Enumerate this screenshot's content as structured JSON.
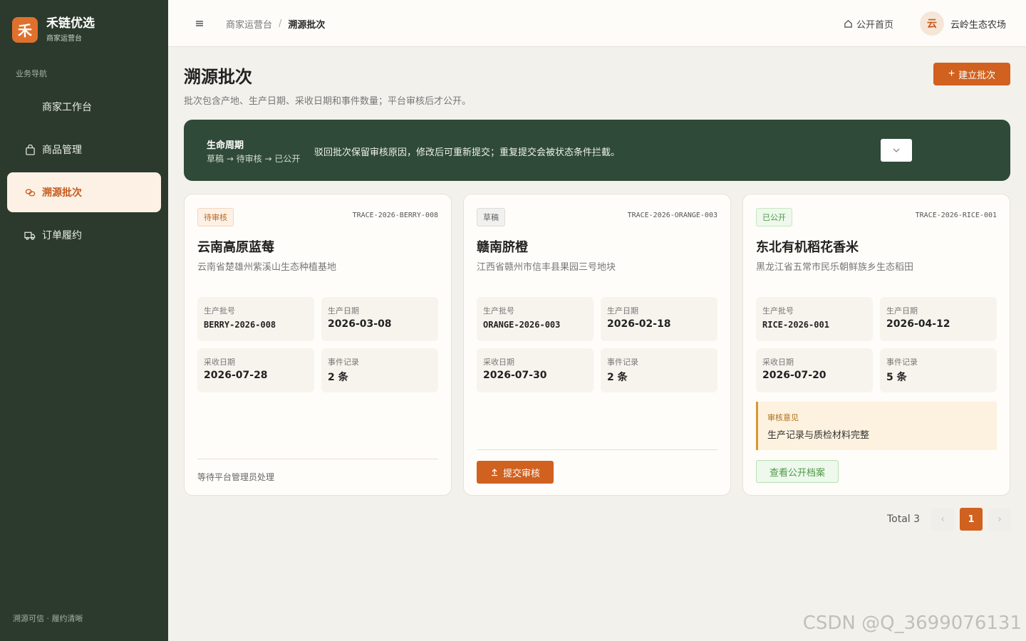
{
  "brand": {
    "logo_char": "禾",
    "title": "禾链优选",
    "subtitle": "商家运营台"
  },
  "sidebar": {
    "section_label": "业务导航",
    "items": [
      {
        "label": "商家工作台",
        "icon": "none",
        "active": false
      },
      {
        "label": "商品管理",
        "icon": "bag-icon",
        "active": false
      },
      {
        "label": "溯源批次",
        "icon": "link-icon",
        "active": true
      },
      {
        "label": "订单履约",
        "icon": "truck-icon",
        "active": false
      }
    ],
    "footer": "溯源可信 · 履约清晰"
  },
  "topbar": {
    "breadcrumb": [
      "商家运营台",
      "溯源批次"
    ],
    "breadcrumb_sep": "/",
    "home_link": "公开首页",
    "user": {
      "avatar_char": "云",
      "name": "云岭生态农场"
    }
  },
  "page": {
    "title": "溯源批次",
    "description": "批次包含产地、生产日期、采收日期和事件数量；平台审核后才公开。",
    "add_button": "建立批次"
  },
  "lifecycle": {
    "title": "生命周期",
    "flow": "草稿 → 待审核 → 已公开",
    "text": "驳回批次保留审核原因，修改后可重新提交；重复提交会被状态条件拦截。"
  },
  "labels": {
    "batch_no": "生产批号",
    "production_date": "生产日期",
    "harvest_date": "采收日期",
    "events": "事件记录"
  },
  "cards": [
    {
      "status": "待审核",
      "code": "TRACE-2026-BERRY-008",
      "title": "云南高原蓝莓",
      "origin": "云南省楚雄州紫溪山生态种植基地",
      "batch_no": "BERRY-2026-008",
      "production_date": "2026-03-08",
      "harvest_date": "2026-07-28",
      "events": "2 条",
      "footer_text": "等待平台管理员处理"
    },
    {
      "status": "草稿",
      "code": "TRACE-2026-ORANGE-003",
      "title": "赣南脐橙",
      "origin": "江西省赣州市信丰县果园三号地块",
      "batch_no": "ORANGE-2026-003",
      "production_date": "2026-02-18",
      "harvest_date": "2026-07-30",
      "events": "2 条",
      "action": "提交审核"
    },
    {
      "status": "已公开",
      "code": "TRACE-2026-RICE-001",
      "title": "东北有机稻花香米",
      "origin": "黑龙江省五常市民乐朝鲜族乡生态稻田",
      "batch_no": "RICE-2026-001",
      "production_date": "2026-04-12",
      "harvest_date": "2026-07-20",
      "events": "5 条",
      "review_label": "审核意见",
      "review_text": "生产记录与质检材料完整",
      "action": "查看公开档案"
    }
  ],
  "pagination": {
    "total_text": "Total 3",
    "current": "1",
    "prev": "‹",
    "next": "›"
  },
  "watermark": "CSDN @Q_3699076131",
  "colors": {
    "sidebar": "#2b3a2d",
    "accent": "#d0611f",
    "lifecycle": "#2f4a38"
  }
}
